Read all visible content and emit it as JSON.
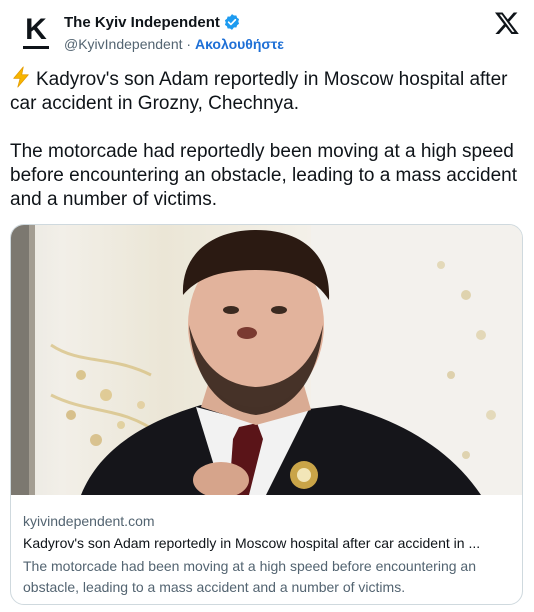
{
  "header": {
    "avatar_letter": "K",
    "display_name": "The Kyiv Independent",
    "handle": "@KyivIndependent",
    "separator": "·",
    "follow_label": "Ακολουθήστε",
    "verified_color": "#1d9bf0",
    "follow_color": "#1d6fd6",
    "platform_icon": "x-logo-icon"
  },
  "tweet": {
    "emoji_icon": "high-voltage-icon",
    "paragraph1": "Kadyrov's son Adam reportedly in Moscow hospital after car accident in Grozny, Chechnya.",
    "paragraph2": "The motorcade had reportedly been moving at a high speed before encountering an obstacle, leading to a mass accident and a number of victims."
  },
  "card": {
    "domain": "kyivindependent.com",
    "title": "Kadyrov's son Adam reportedly in Moscow hospital after car accident in ...",
    "description": "The motorcade had been moving at a high speed before encountering an obstacle, leading to a mass accident and a number of victims."
  }
}
